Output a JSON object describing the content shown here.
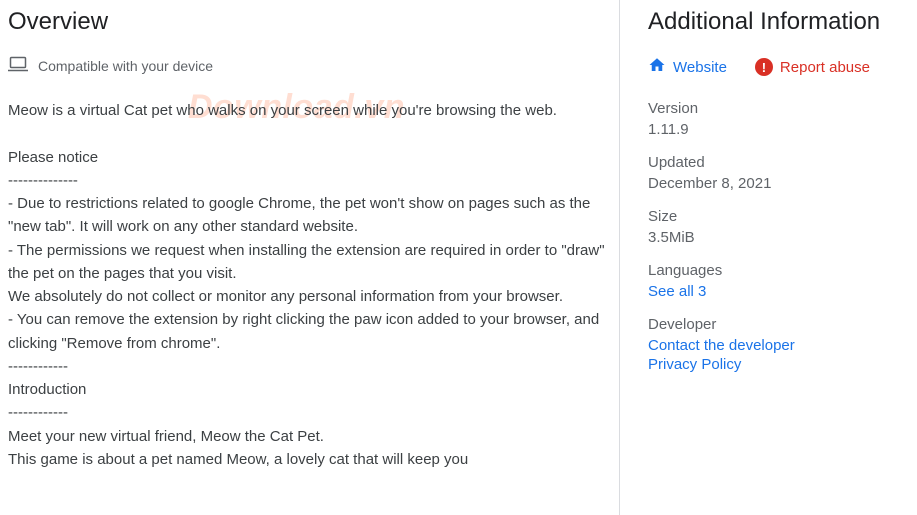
{
  "overview": {
    "title": "Overview",
    "compatible_text": "Compatible with your device",
    "description": "Meow is a virtual Cat pet who walks on your screen while you're browsing the web.\n\nPlease notice\n--------------\n- Due to restrictions related to google Chrome, the pet won't show on pages such as the \"new tab\". It will work on any other standard website.\n- The permissions we request when installing the extension are required in order to \"draw\" the pet on the pages that you visit.\nWe absolutely do not collect or monitor any personal information from your browser.\n- You can remove the extension by right clicking the paw icon added to your browser, and clicking \"Remove from chrome\".\n------------\nIntroduction\n------------\nMeet your new virtual friend, Meow the Cat Pet.\nThis game is about a pet named Meow, a lovely cat that will keep you"
  },
  "additional": {
    "title": "Additional Information",
    "website_label": "Website",
    "report_label": "Report abuse",
    "version_label": "Version",
    "version_value": "1.11.9",
    "updated_label": "Updated",
    "updated_value": "December 8, 2021",
    "size_label": "Size",
    "size_value": "3.5MiB",
    "languages_label": "Languages",
    "languages_link": "See all 3",
    "developer_label": "Developer",
    "developer_contact": "Contact the developer",
    "developer_privacy": "Privacy Policy"
  },
  "watermark_text": "Download.vn"
}
